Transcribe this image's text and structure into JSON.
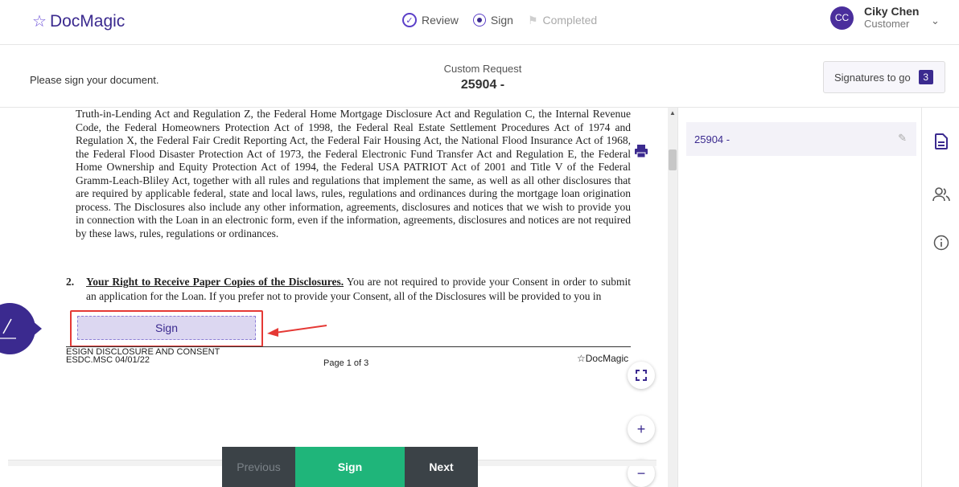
{
  "header": {
    "brand": "DocMagic",
    "steps": [
      {
        "label": "Review"
      },
      {
        "label": "Sign"
      },
      {
        "label": "Completed"
      }
    ],
    "user": {
      "initials": "CC",
      "name": "Ciky Chen",
      "role": "Customer"
    }
  },
  "subbar": {
    "instruction": "Please sign your document.",
    "request_title": "Custom Request",
    "request_number": "25904 -",
    "signatures_label": "Signatures to go",
    "signatures_count": "3"
  },
  "document": {
    "paragraph1": "Truth-in-Lending Act and Regulation Z, the Federal Home Mortgage Disclosure Act and Regulation C, the Internal Revenue Code, the Federal Homeowners Protection Act of 1998, the Federal Real Estate Settlement Procedures Act of 1974 and Regulation X, the Federal Fair Credit Reporting Act, the Federal Fair Housing Act, the National Flood Insurance Act of 1968, the Federal Flood Disaster Protection Act of 1973, the Federal Electronic Fund Transfer Act and Regulation E, the Federal Home Ownership and Equity Protection Act of 1994, the Federal USA PATRIOT Act of 2001 and Title V of the Federal Gramm-Leach-Bliley Act, together with all rules and regulations that implement the same, as well as all other disclosures that are required by applicable federal, state and local laws, rules, regulations and ordinances during the mortgage loan origination process. The Disclosures also include any other information, agreements, disclosures and notices that we wish to provide you in connection with the Loan in an electronic form, even if the information, agreements, disclosures and notices are not required by these laws, rules, regulations or ordinances.",
    "para2_index": "2.",
    "para2_heading": "Your Right to Receive Paper Copies of the Disclosures.",
    "para2_text": " You are not required to provide your Consent in order to submit an application for the Loan. If you prefer not to provide your Consent, all of the Disclosures will be provided to you in",
    "sign_field": "Sign",
    "footer_title": "ESIGN DISCLOSURE AND CONSENT",
    "footer_code": "ESDC.MSC 04/01/22",
    "footer_page": "Page 1 of 3",
    "footer_brand": "DocMagic"
  },
  "nav": {
    "previous": "Previous",
    "sign": "Sign",
    "next": "Next"
  },
  "zoom": {
    "plus": "+",
    "minus": "−"
  },
  "sidebar": {
    "doc_item": "25904 -"
  },
  "colors": {
    "brand": "#3b2a8f",
    "sign_green": "#1fb57a",
    "highlight": "#e53935"
  }
}
